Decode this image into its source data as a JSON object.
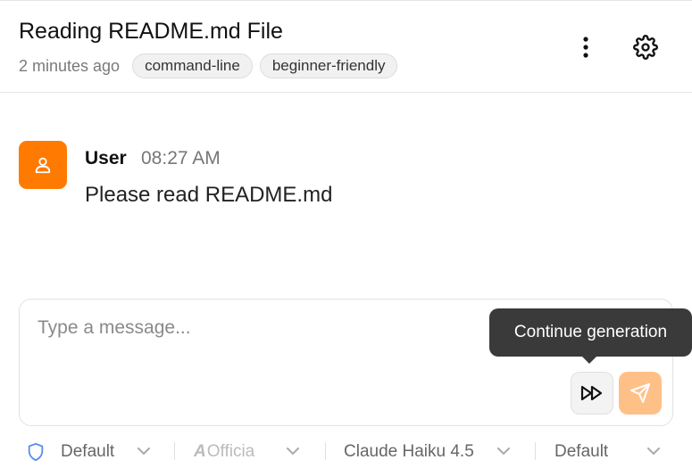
{
  "header": {
    "title": "Reading README.md File",
    "time_ago": "2 minutes ago",
    "tags": [
      "command-line",
      "beginner-friendly"
    ],
    "more_icon": "more-vertical-icon",
    "settings_icon": "gear-icon"
  },
  "message": {
    "sender": "User",
    "time": "08:27 AM",
    "text": "Please read README.md",
    "avatar_icon": "user-icon",
    "avatar_color": "#ff7a00"
  },
  "composer": {
    "placeholder": "Type a message...",
    "value": "",
    "continue_icon": "fast-forward-icon",
    "send_icon": "send-icon",
    "send_color": "#ffc088"
  },
  "tooltip": {
    "text": "Continue generation"
  },
  "bottom_bar": {
    "permission": "Default",
    "agent_prefix": "A",
    "agent": "Officia",
    "model": "Claude Haiku 4.5",
    "mode": "Default"
  }
}
